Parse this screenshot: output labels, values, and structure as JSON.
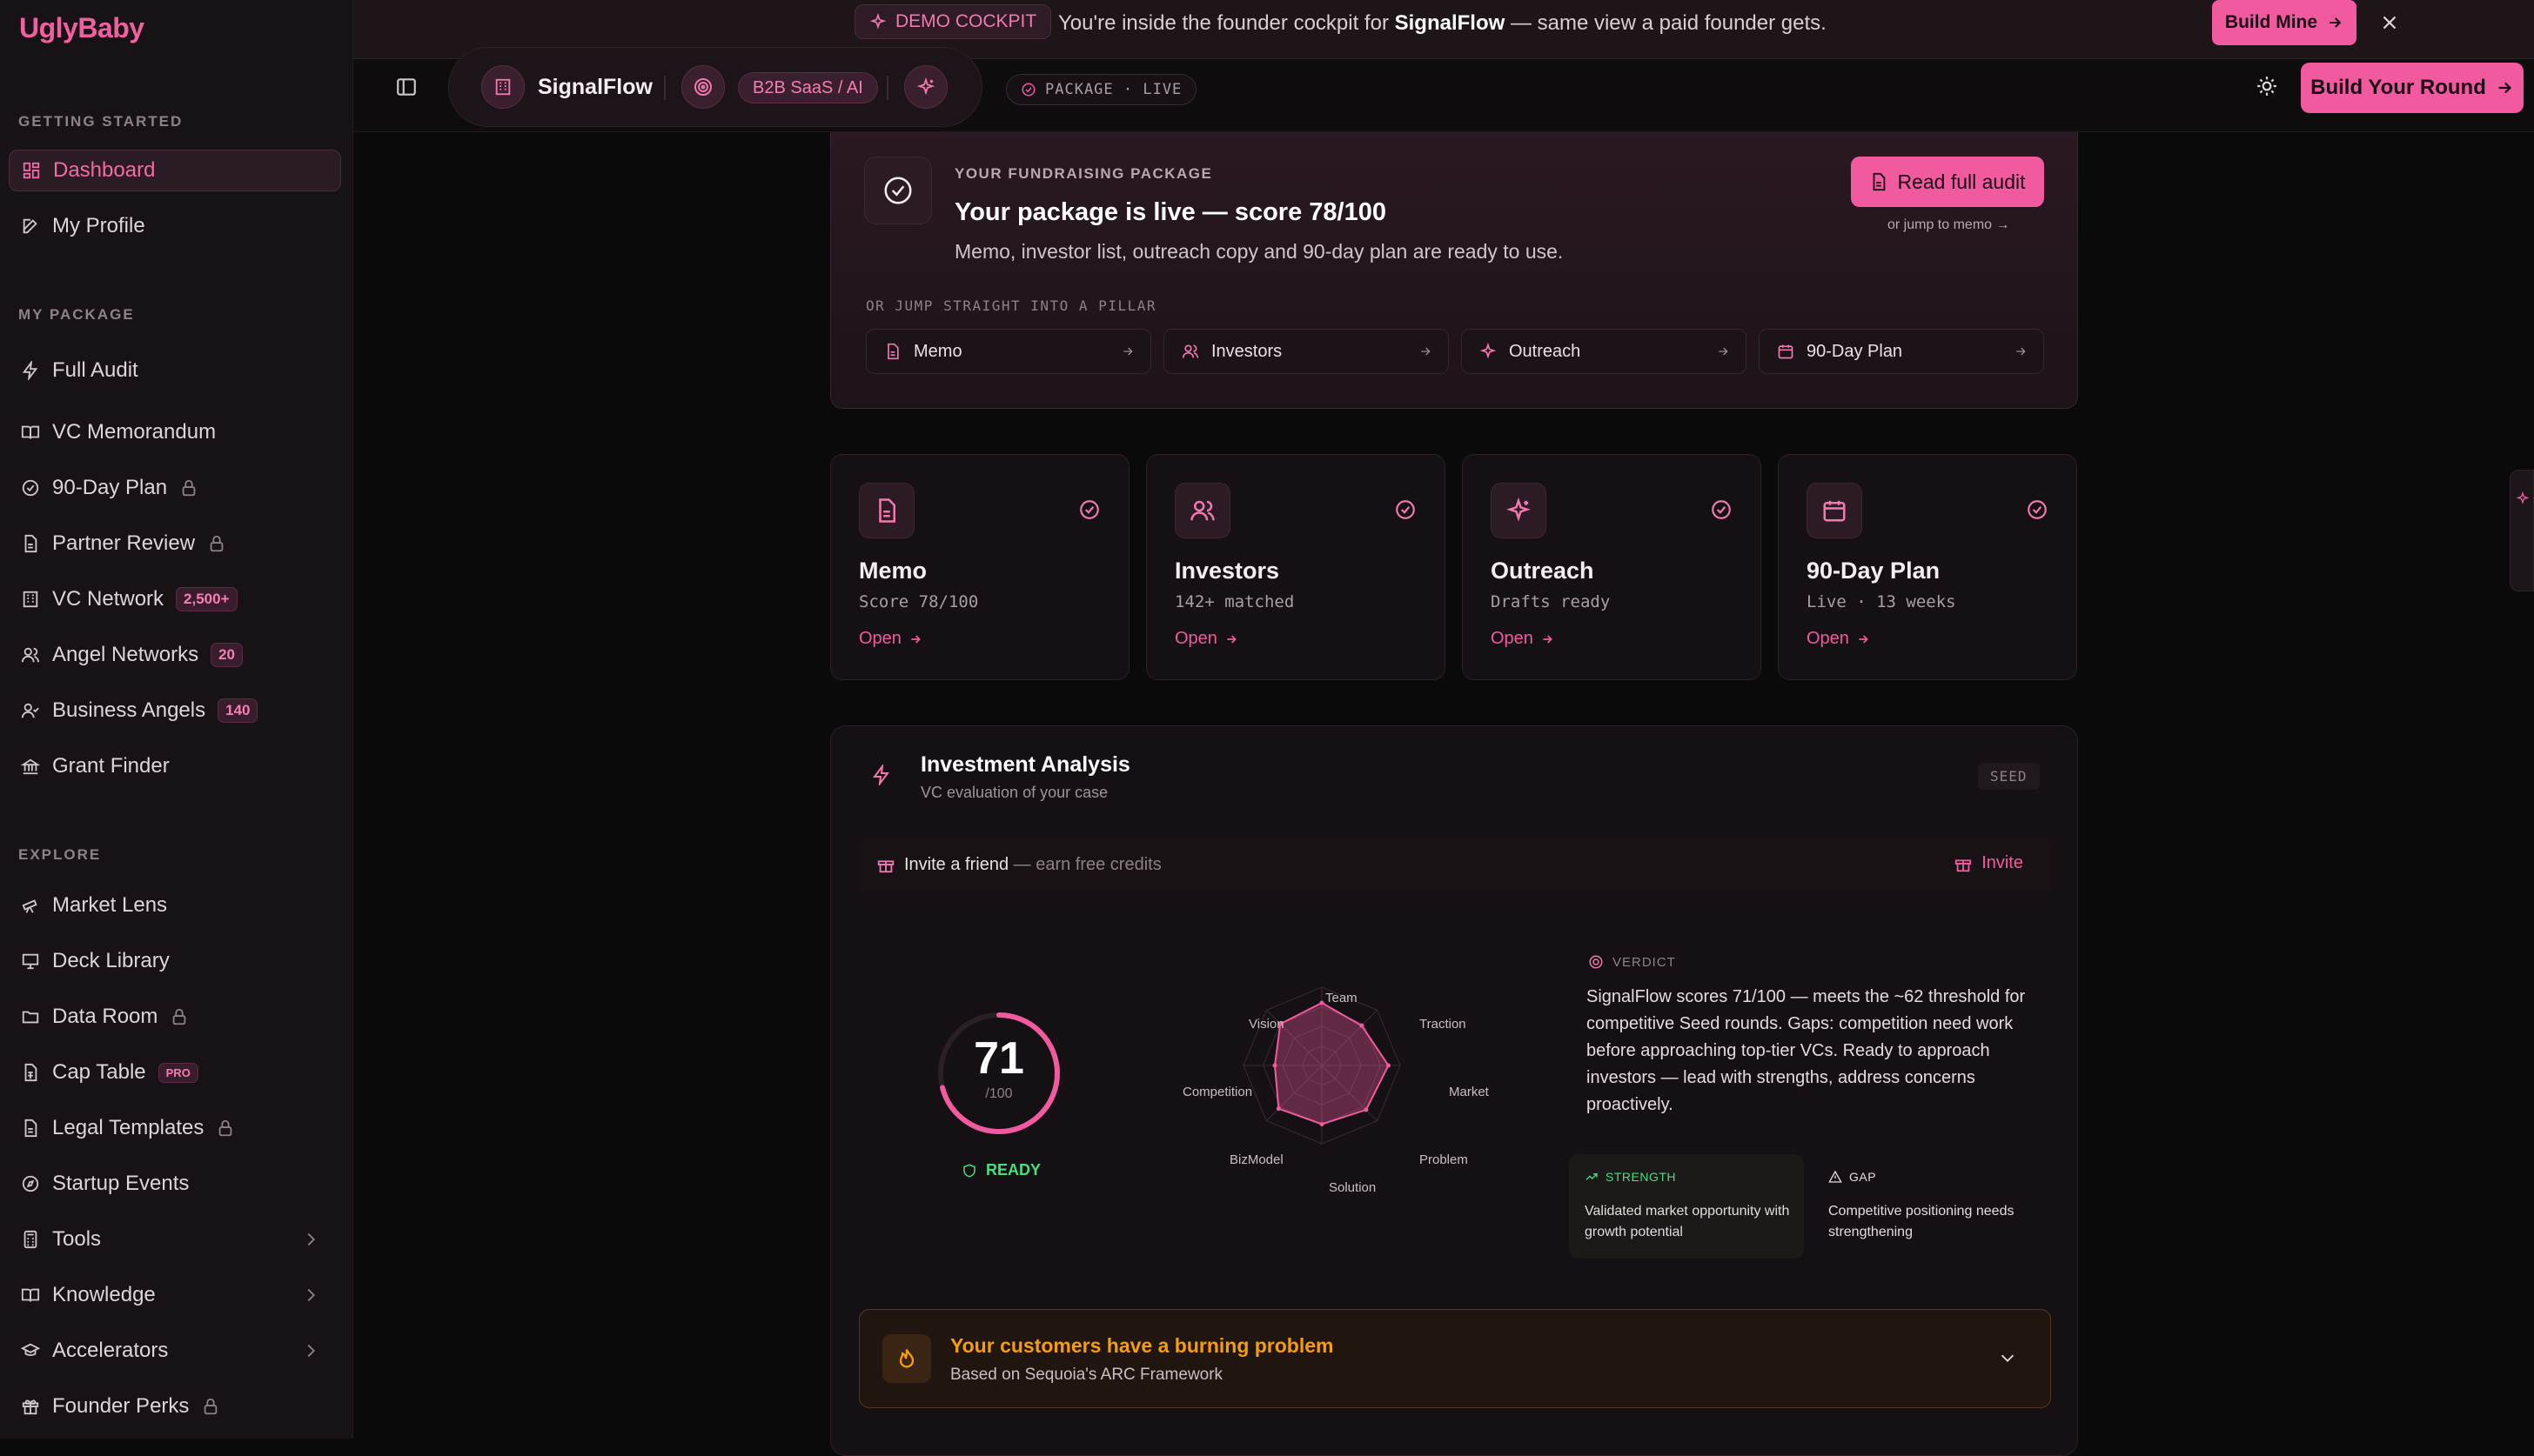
{
  "app": {
    "logo": "UglyBaby"
  },
  "sidebar": {
    "sections": [
      {
        "title": "GETTING STARTED"
      },
      {
        "title": "MY PACKAGE"
      },
      {
        "title": "EXPLORE"
      }
    ],
    "items": {
      "dashboard": "Dashboard",
      "my_profile": "My Profile",
      "full_audit": "Full Audit",
      "vc_memorandum": "VC Memorandum",
      "plan_90": "90-Day Plan",
      "partner_review": "Partner Review",
      "vc_network": "VC Network",
      "vc_network_badge": "2,500+",
      "angel_networks": "Angel Networks",
      "angel_networks_badge": "20",
      "business_angels": "Business Angels",
      "business_angels_badge": "140",
      "grant_finder": "Grant Finder",
      "market_lens": "Market Lens",
      "deck_library": "Deck Library",
      "data_room": "Data Room",
      "cap_table": "Cap Table",
      "cap_table_badge": "PRO",
      "legal_templates": "Legal Templates",
      "startup_events": "Startup Events",
      "tools": "Tools",
      "knowledge": "Knowledge",
      "accelerators": "Accelerators",
      "founder_perks": "Founder Perks"
    }
  },
  "banner": {
    "demo_label": "DEMO COCKPIT",
    "text_before": "You're inside the founder cockpit for ",
    "company": "SignalFlow",
    "text_after": " — same view a paid founder gets.",
    "build_mine": "Build Mine"
  },
  "header": {
    "company": "SignalFlow",
    "sector": "B2B SaaS / AI",
    "status": "PACKAGE · LIVE",
    "build_round": "Build Your Round"
  },
  "package": {
    "eyebrow": "YOUR FUNDRAISING PACKAGE",
    "title": "Your package is live — score 78/100",
    "subtitle": "Memo, investor list, outreach copy and 90-day plan are ready to use.",
    "read_audit": "Read full audit",
    "jump_memo": "or jump to memo →",
    "jump_label": "OR JUMP STRAIGHT INTO A PILLAR",
    "pillars": [
      "Memo",
      "Investors",
      "Outreach",
      "90-Day Plan"
    ]
  },
  "pillar_cards": [
    {
      "title": "Memo",
      "sub": "Score 78/100",
      "open": "Open"
    },
    {
      "title": "Investors",
      "sub": "142+ matched",
      "open": "Open"
    },
    {
      "title": "Outreach",
      "sub": "Drafts ready",
      "open": "Open"
    },
    {
      "title": "90-Day Plan",
      "sub": "Live · 13 weeks",
      "open": "Open"
    }
  ],
  "analysis": {
    "title": "Investment Analysis",
    "subtitle": "VC evaluation of your case",
    "stage": "SEED",
    "invite_text": "Invite a friend",
    "invite_sub": "— earn free credits",
    "invite_btn": "Invite",
    "score": "71",
    "score_den": "/100",
    "score_value": 71,
    "ready": "READY",
    "verdict_label": "VERDICT",
    "verdict": "SignalFlow scores 71/100 — meets the ~62 threshold for competitive Seed rounds. Gaps: competition need work before approaching top-tier VCs. Ready to approach investors — lead with strengths, address concerns proactively.",
    "strength_label": "STRENGTH",
    "strength": "Validated market opportunity with growth potential",
    "gap_label": "GAP",
    "gap": "Competitive positioning needs strengthening",
    "burning_title": "Your customers have a burning problem",
    "burning_sub": "Based on Sequoia's ARC Framework"
  },
  "chart_data": {
    "type": "radar",
    "categories": [
      "Team",
      "Traction",
      "Market",
      "Problem",
      "Solution",
      "BizModel",
      "Competition",
      "Vision"
    ],
    "values": [
      0.8,
      0.72,
      0.85,
      0.8,
      0.75,
      0.78,
      0.6,
      0.75
    ],
    "range": [
      0,
      1
    ]
  },
  "colors": {
    "accent": "#f25aa0",
    "ready": "#4ade80"
  }
}
